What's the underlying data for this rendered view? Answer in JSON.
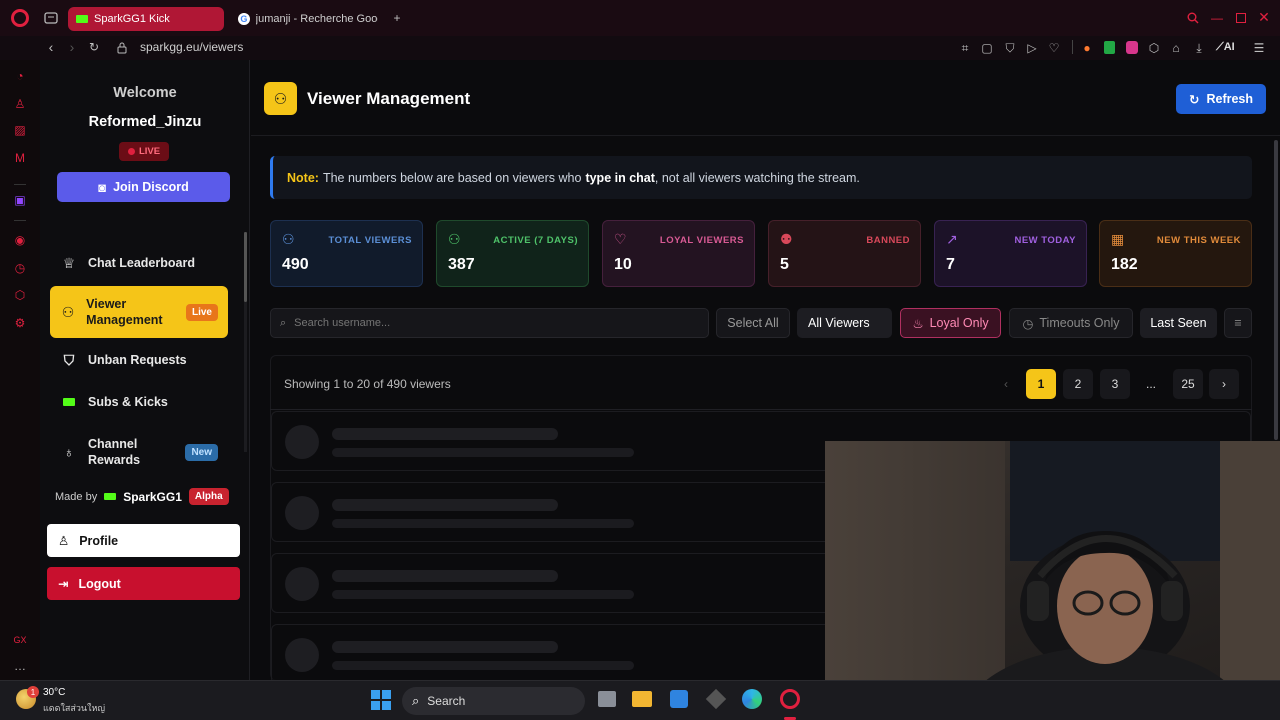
{
  "browser": {
    "tabs": [
      {
        "label": "SparkGG1 Kick",
        "active": true
      },
      {
        "label": "jumanji - Recherche Googl",
        "active": false
      }
    ],
    "url": "sparkgg.eu/viewers",
    "ai_label": "AI"
  },
  "sidebar": {
    "welcome": "Welcome",
    "username": "Reformed_Jinzu",
    "live_badge": "LIVE",
    "discord_button": "Join Discord",
    "nav": [
      {
        "label": "Chat Leaderboard",
        "icon": "trophy-icon"
      },
      {
        "label": "Viewer Management",
        "icon": "users-icon",
        "badge": "Live",
        "active": true
      },
      {
        "label": "Unban Requests",
        "icon": "shield-icon"
      },
      {
        "label": "Subs & Kicks",
        "icon": "kick-icon"
      },
      {
        "label": "Channel Rewards",
        "icon": "award-icon",
        "badge": "New"
      }
    ],
    "made_by": "Made by",
    "brand": "SparkGG1",
    "alpha": "Alpha",
    "profile_button": "Profile",
    "logout_button": "Logout"
  },
  "main": {
    "title": "Viewer Management",
    "refresh_button": "Refresh",
    "note_prefix": "Note:",
    "note_text_1": "The numbers below are based on viewers who",
    "note_bold": "type in chat",
    "note_text_2": ", not all viewers watching the stream.",
    "stats": [
      {
        "label": "TOTAL VIEWERS",
        "value": "490",
        "color": "#5b8fd6"
      },
      {
        "label": "ACTIVE (7 DAYS)",
        "value": "387",
        "color": "#4fc36a"
      },
      {
        "label": "LOYAL VIEWERS",
        "value": "10",
        "color": "#d85a94"
      },
      {
        "label": "BANNED",
        "value": "5",
        "color": "#d8485a"
      },
      {
        "label": "NEW TODAY",
        "value": "7",
        "color": "#a060e0"
      },
      {
        "label": "NEW THIS WEEK",
        "value": "182",
        "color": "#e08a3a"
      }
    ],
    "search_placeholder": "Search username...",
    "filters": {
      "select_all": "Select All",
      "all_viewers": "All Viewers",
      "loyal_only": "Loyal Only",
      "timeouts_only": "Timeouts Only",
      "last_seen": "Last Seen"
    },
    "showing": "Showing 1 to 20 of 490 viewers",
    "pagination": {
      "pages": [
        "1",
        "2",
        "3",
        "...",
        "25"
      ],
      "current": "1",
      "prev": "‹",
      "next": "›"
    }
  },
  "taskbar": {
    "temp": "30°C",
    "weather_text": "แดดใสส่วนใหญ่",
    "search_label": "Search",
    "notification_count": "1"
  }
}
